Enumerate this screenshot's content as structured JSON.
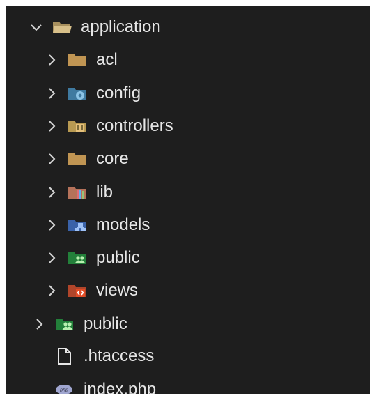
{
  "tree": {
    "root": {
      "label": "application",
      "expanded": true,
      "icon": "folder-open-icon",
      "children": [
        {
          "label": "acl",
          "icon": "folder-icon"
        },
        {
          "label": "config",
          "icon": "folder-config-icon"
        },
        {
          "label": "controllers",
          "icon": "folder-controllers-icon"
        },
        {
          "label": "core",
          "icon": "folder-icon"
        },
        {
          "label": "lib",
          "icon": "folder-lib-icon"
        },
        {
          "label": "models",
          "icon": "folder-models-icon"
        },
        {
          "label": "public",
          "icon": "folder-public-icon"
        },
        {
          "label": "views",
          "icon": "folder-views-icon"
        }
      ]
    },
    "top_level": [
      {
        "label": "public",
        "icon": "folder-public-icon"
      },
      {
        "label": ".htaccess",
        "icon": "file-icon"
      },
      {
        "label": "index.php",
        "icon": "php-file-icon"
      }
    ]
  },
  "colors": {
    "background": "#1e1e1e",
    "text": "#e6e6e6",
    "folder": "#c09553",
    "config": "#519aba",
    "controllers": "#e5c07b",
    "models": "#4a7bd1",
    "public": "#2e8b3a",
    "views": "#e34c26"
  }
}
